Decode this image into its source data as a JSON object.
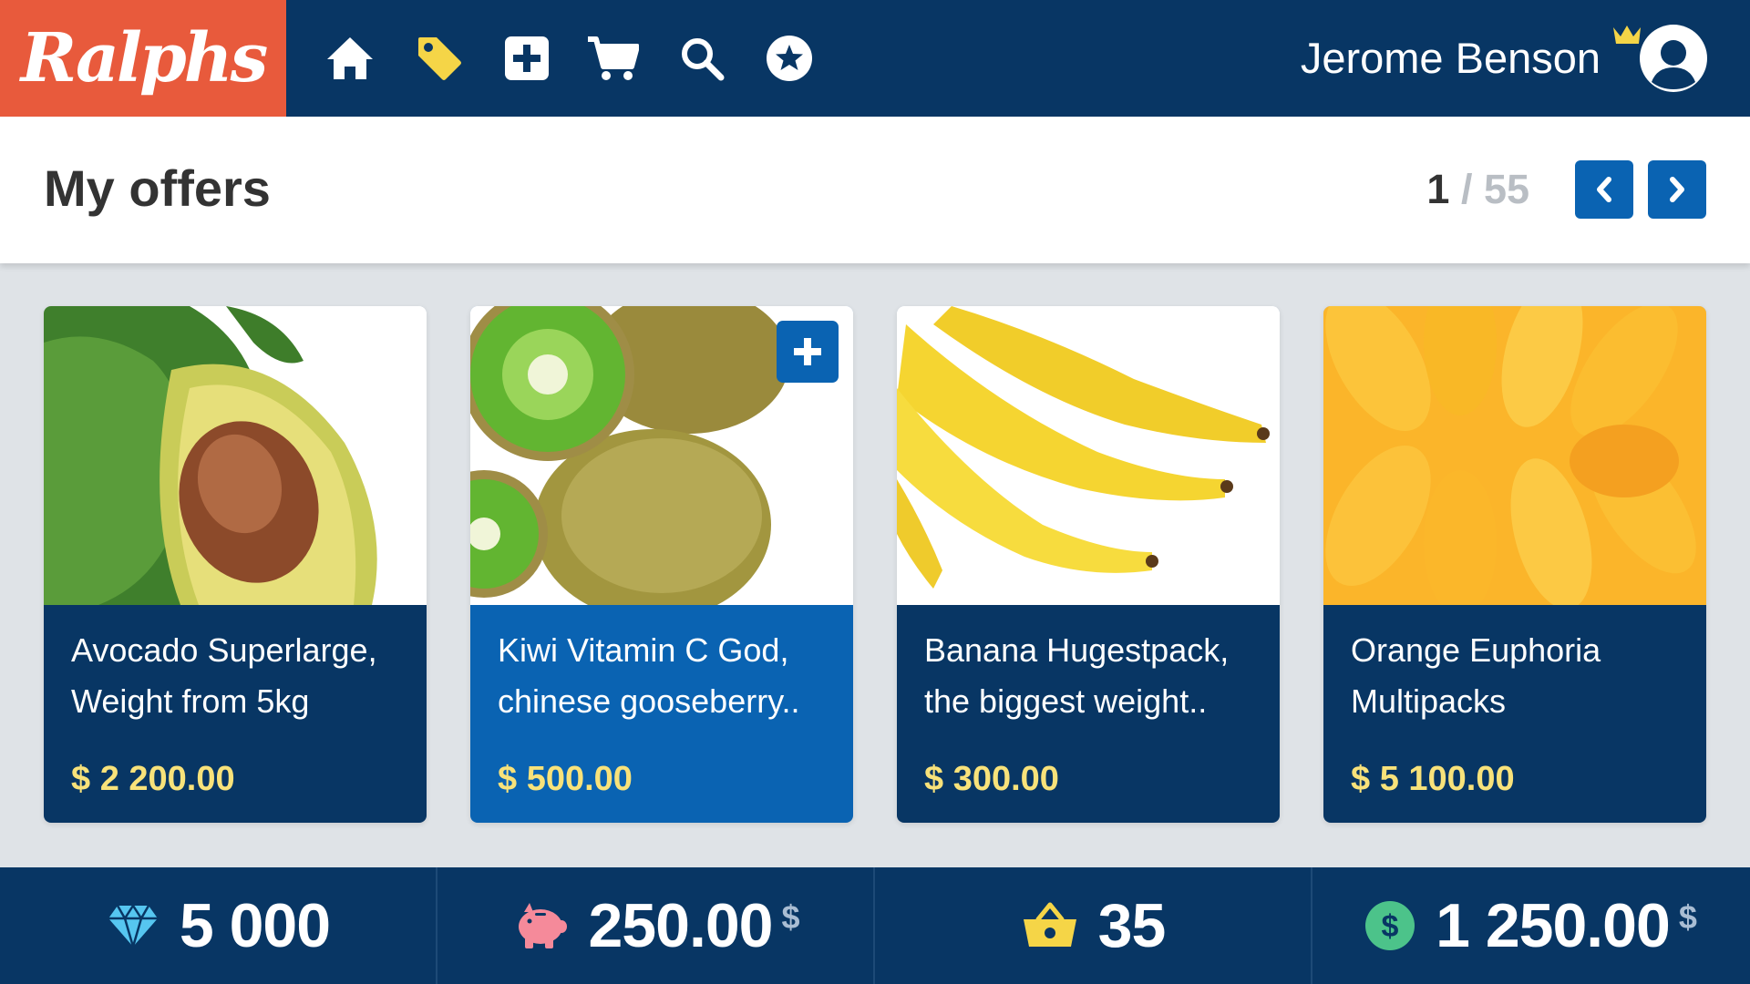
{
  "header": {
    "logo_text": "Ralphs",
    "nav_icons": [
      "home-icon",
      "tag-icon",
      "plus-square-icon",
      "cart-icon",
      "search-icon",
      "star-icon"
    ],
    "user_name": "Jerome Benson"
  },
  "page": {
    "title": "My offers",
    "pager_current": "1",
    "pager_total": "/ 55"
  },
  "products": [
    {
      "name": "Avocado Superlarge, Weight from 5kg",
      "price": "$ 2 200.00",
      "image": "avocado"
    },
    {
      "name": "Kiwi Vitamin C God, chinese gooseberry..",
      "price": "$ 500.00",
      "image": "kiwi",
      "active": true
    },
    {
      "name": "Banana Hugestpack, the biggest weight..",
      "price": "$ 300.00",
      "image": "banana"
    },
    {
      "name": "Orange Euphoria Multipacks",
      "price": "$ 5 100.00",
      "image": "orange"
    }
  ],
  "stats": [
    {
      "icon": "diamond-icon",
      "value": "5 000",
      "currency": ""
    },
    {
      "icon": "piggy-bank-icon",
      "value": "250.00",
      "currency": "$"
    },
    {
      "icon": "basket-icon",
      "value": "35",
      "currency": ""
    },
    {
      "icon": "dollar-coin-icon",
      "value": "1 250.00",
      "currency": "$"
    }
  ],
  "colors": {
    "brand": "#e85a3c",
    "navy": "#083664",
    "accent_blue": "#0a63b2",
    "price_yellow": "#f8e27a"
  }
}
